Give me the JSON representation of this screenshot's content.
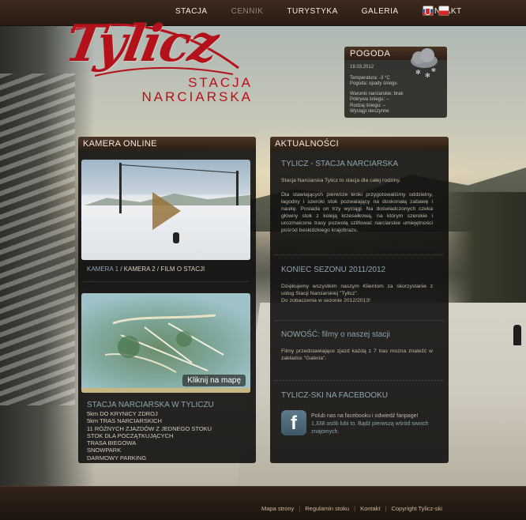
{
  "nav": {
    "items": [
      "STACJA",
      "CENNIK",
      "TURYSTYKA",
      "GALERIA",
      "KONTAKT"
    ],
    "active": "CENNIK",
    "flags": [
      "flag-sk-icon",
      "flag-pl-icon"
    ]
  },
  "logo": {
    "script": "Tylicz",
    "line1": "STACJA",
    "line2": "NARCIARSKA",
    "color": "#b3121b"
  },
  "weather": {
    "title": "POGODA",
    "date": "19.03.2012",
    "temperature": "Temperatura: -3 °C",
    "conditions": "Pogoda: opady śniegu",
    "ski_conditions": "Warunki narciarskie: brak",
    "snow_cover": "Pokrywa śniegu:        --",
    "snow_type": "Rodzaj śniegu:          --",
    "lifts": "Wyciągi nieczynne",
    "icon": "snow-cloud-icon"
  },
  "camera": {
    "title": "KAMERA ONLINE",
    "link1": "KAMERA 1",
    "sep1": " / ",
    "link2": "KAMERA 2",
    "sep2": " / ",
    "link3": "FILM O STACJI"
  },
  "map": {
    "cta": "Kliknij na mapę"
  },
  "station": {
    "title": "STACJA NARCIARSKA W TYLICZU",
    "features": [
      "5km DO KRYNICY ZDROJ",
      "5km TRAS NARCIARSKICH",
      "11 RÓŻNYCH ZJAZDÓW Z JEDNEGO STOKU",
      "STOK DLA POCZĄTKUJĄCYCH",
      "TRASA BIEGOWA",
      "SNOWPARK",
      "DARMOWY PARKING"
    ]
  },
  "news": {
    "title": "AKTUALNOŚCI",
    "items": [
      {
        "heading": "TYLICZ - STACJA NARCIARSKA",
        "p1": "Stacja Narciarska Tylicz to stacja dla całej rodziny.",
        "p2": "Dla stawiających pierwsze kroki przygotowaliśmy oddzielny, łagodny i szeroki stok pozwalający na doskonałą zabawę i naukę. Posiada on trzy wyciągi. Na doświadczonych czeka główny stok z koleją krzesełkową, na którym szerokie i urozmaicone trasy pozwolą szlifować narciarskie umiejętności pośród beskidzkiego krajobrazu."
      },
      {
        "heading": "KONIEC SEZONU 2011/2012",
        "p1": "Dziękujemy wszystkim naszym Klientom za skorzystanie z usług Stacji Narciarskiej \"Tylicz\".",
        "p2": "Do zobaczenia w sezonie 2012/2013!"
      },
      {
        "heading": "NOWOŚĆ: filmy o naszej stacji",
        "p1": "Filmy przedstawiające zjazd każdą z 7 tras można znaleźć w zakładce \"Galeria\".",
        "p2": ""
      }
    ],
    "facebook": {
      "heading": "TYLICZ-SKI NA FACEBOOKU",
      "line1": "Polub nas na facebooku i odwiedź fanpage!",
      "line2": "1,338 osób lubi to. Bądź pierwszą wśród swoich znajomych.",
      "icon": "facebook-icon"
    }
  },
  "footer": {
    "links": [
      "Mapa strony",
      "Regulamin stoku",
      "Kontakt",
      "Copyright Tylicz-ski"
    ]
  }
}
